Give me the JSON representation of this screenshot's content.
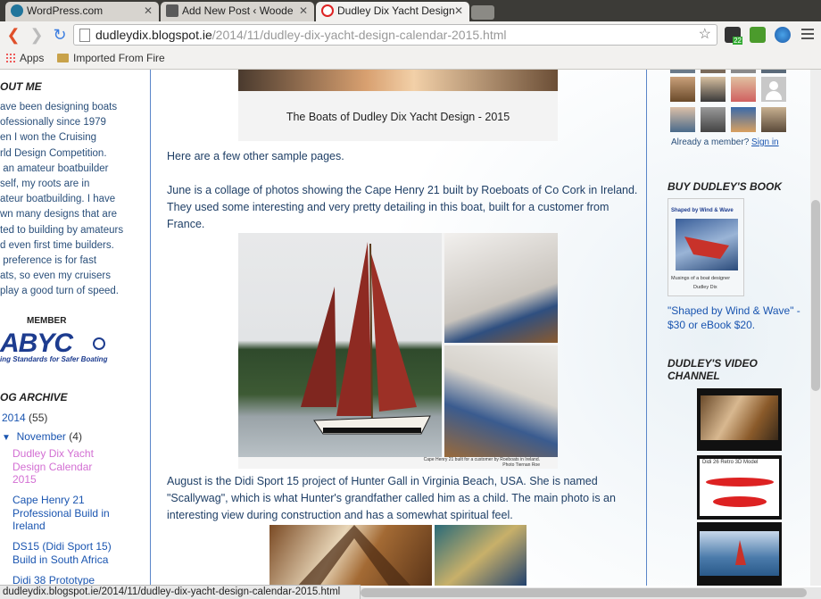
{
  "tabs": [
    {
      "title": "WordPress.com"
    },
    {
      "title": "Add New Post ‹ Woode"
    },
    {
      "title": "Dudley Dix Yacht Design"
    }
  ],
  "address": {
    "host": "dudleydix.blogspot.ie",
    "path": "/2014/11/dudley-dix-yacht-design-calendar-2015.html"
  },
  "extensions": {
    "badge": "22"
  },
  "bookmarks": [
    {
      "label": "Apps"
    },
    {
      "label": "Imported From Fire"
    }
  ],
  "left_sidebar": {
    "about_title": "OUT ME",
    "about_text": "ave been designing boats\nofessionally since 1979\nen I won the Cruising\nrld Design Competition.\n an amateur boatbuilder\nself, my roots are in\nateur boatbuilding. I have\nwn many designs that are\nted to building by amateurs\nd even first time builders.\n preference is for fast\nats, so even my cruisers\nplay a good turn of speed.",
    "member_label": "MEMBER",
    "abyc_logo": "ABYC",
    "abyc_tagline": "ing Standards for Safer Boating",
    "archive_title": "OG ARCHIVE",
    "archive": [
      {
        "label": "2014",
        "count": "(55)",
        "marker": "▸"
      },
      {
        "label": "November",
        "count": "(4)",
        "marker": "▼"
      },
      {
        "label": "Dudley Dix Yacht\nDesign Calendar\n2015"
      },
      {
        "label": "Cape Henry 21\nProfessional Build in\nIreland"
      },
      {
        "label": "DS15 (Didi Sport 15)\nBuild in South Africa"
      },
      {
        "label": "Didi 38 Prototype"
      }
    ]
  },
  "main": {
    "caption": "The Boats of Dudley Dix Yacht Design - 2015",
    "para1": "Here are a few other sample pages.",
    "para2": "June is a collage of photos showing the Cape Henry 21 built by Roeboats of Co Cork in Ireland. They used some interesting and very pretty detailing in this boat, built for a customer from France.",
    "photo_credit": "Cape Henry 21 built for a customer by Roeboats in Ireland.\nPhoto Tiernan Roe",
    "para3": "August is the Didi Sport 15 project of Hunter Gall in Virginia Beach, USA. She is named \"Scallywag\", which is what Hunter's grandfather called him as a child. The main photo is an interesting view during construction and has a somewhat spiritual feel."
  },
  "right_sidebar": {
    "already_member": "Already a member?",
    "sign_in": "Sign in",
    "book_title": "BUY DUDLEY'S BOOK",
    "book_cover_title": "Shaped by Wind & Wave",
    "book_cover_subtitle": "Musings of a boat designer",
    "book_cover_author": "Dudley Dix",
    "book_text": "\"Shaped by Wind & Wave\" - $30 or eBook $20.",
    "video_title": "DUDLEY'S VIDEO\nCHANNEL",
    "video2_label": "Didi 26 Retro 3D Model"
  },
  "status_url": "dudleydix.blogspot.ie/2014/11/dudley-dix-yacht-design-calendar-2015.html"
}
